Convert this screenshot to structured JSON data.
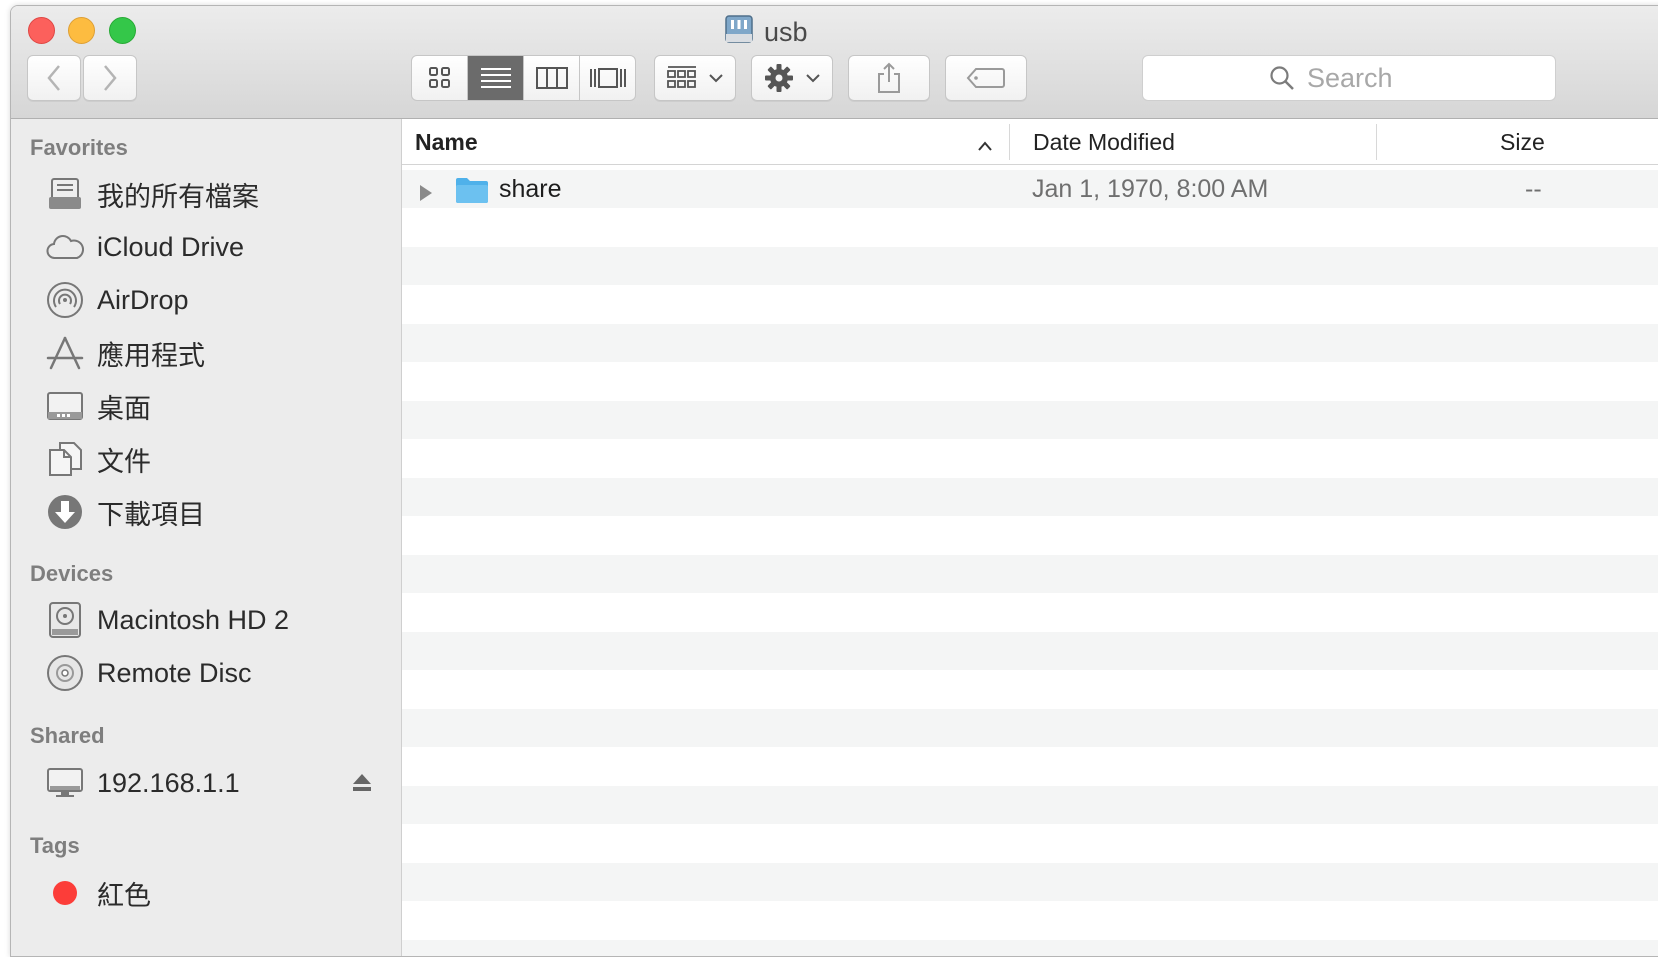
{
  "window": {
    "title": "usb"
  },
  "toolbar": {
    "back_icon": "chevron-left-icon",
    "forward_icon": "chevron-right-icon",
    "view_modes": [
      "icon-view",
      "list-view",
      "column-view",
      "cover-flow-view"
    ],
    "active_view": "list-view",
    "arrange_icon": "arrange-grid-icon",
    "action_icon": "gear-icon",
    "share_icon": "share-icon",
    "tag_icon": "tag-icon"
  },
  "search": {
    "placeholder": "Search"
  },
  "sidebar": {
    "favorites_header": "Favorites",
    "favorites": [
      {
        "label": "我的所有檔案",
        "icon": "all-files-icon"
      },
      {
        "label": "iCloud Drive",
        "icon": "cloud-icon"
      },
      {
        "label": "AirDrop",
        "icon": "airdrop-icon"
      },
      {
        "label": "應用程式",
        "icon": "applications-icon"
      },
      {
        "label": "桌面",
        "icon": "desktop-icon"
      },
      {
        "label": "文件",
        "icon": "documents-icon"
      },
      {
        "label": "下載項目",
        "icon": "downloads-icon"
      }
    ],
    "devices_header": "Devices",
    "devices": [
      {
        "label": "Macintosh HD 2",
        "icon": "hard-disk-icon"
      },
      {
        "label": "Remote Disc",
        "icon": "disc-icon"
      }
    ],
    "shared_header": "Shared",
    "shared": [
      {
        "label": "192.168.1.1",
        "icon": "network-computer-icon"
      }
    ],
    "tags_header": "Tags",
    "tags": [
      {
        "label": "紅色",
        "color": "#fc3d39"
      }
    ]
  },
  "table": {
    "columns": {
      "name": "Name",
      "date": "Date Modified",
      "size": "Size"
    },
    "sort_indicator": "^",
    "rows": [
      {
        "name": "share",
        "date": "Jan 1, 1970, 8:00 AM",
        "size": "--",
        "kind": "folder"
      }
    ]
  },
  "colors": {
    "folder_blue": "#6cc1f0",
    "tag_red": "#fc3d39",
    "active_segment": "#6b6b6b"
  }
}
